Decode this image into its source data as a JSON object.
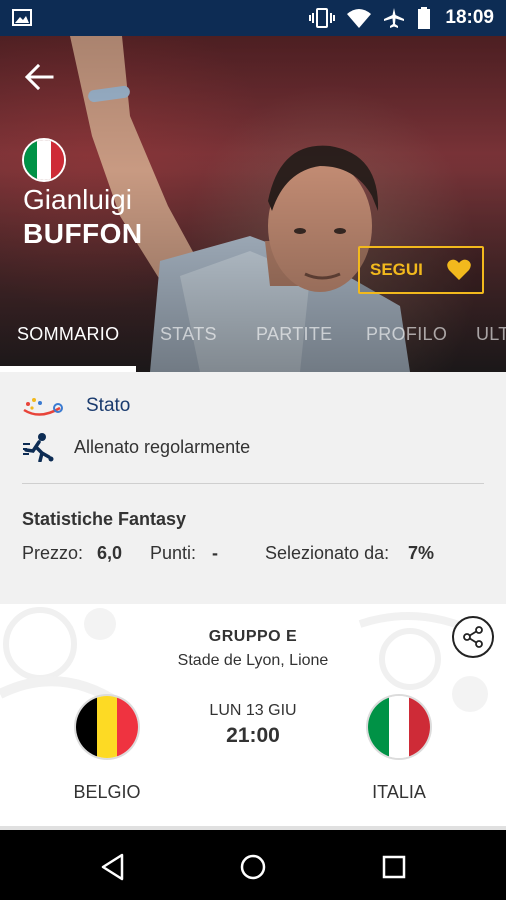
{
  "status_bar": {
    "time": "18:09"
  },
  "hero": {
    "first_name": "Gianluigi",
    "last_name": "BUFFON",
    "follow_label": "SEGUI",
    "tabs": [
      "SOMMARIO",
      "STATS",
      "PARTITE",
      "PROFILO",
      "ULT"
    ]
  },
  "status": {
    "label": "Stato",
    "condition": "Allenato regolarmente"
  },
  "fantasy": {
    "title": "Statistiche Fantasy",
    "price_label": "Prezzo:",
    "price_value": "6,0",
    "points_label": "Punti:",
    "points_value": "-",
    "selected_label": "Selezionato da:",
    "selected_value": "7%"
  },
  "match": {
    "group": "GRUPPO E",
    "stadium": "Stade de Lyon, Lione",
    "date": "LUN 13 GIU",
    "time": "21:00",
    "home_team": "BELGIO",
    "away_team": "ITALIA"
  },
  "colors": {
    "accent_gold": "#f2b91d",
    "navy": "#0d2c54",
    "stato_blue": "#1a3b6e"
  }
}
